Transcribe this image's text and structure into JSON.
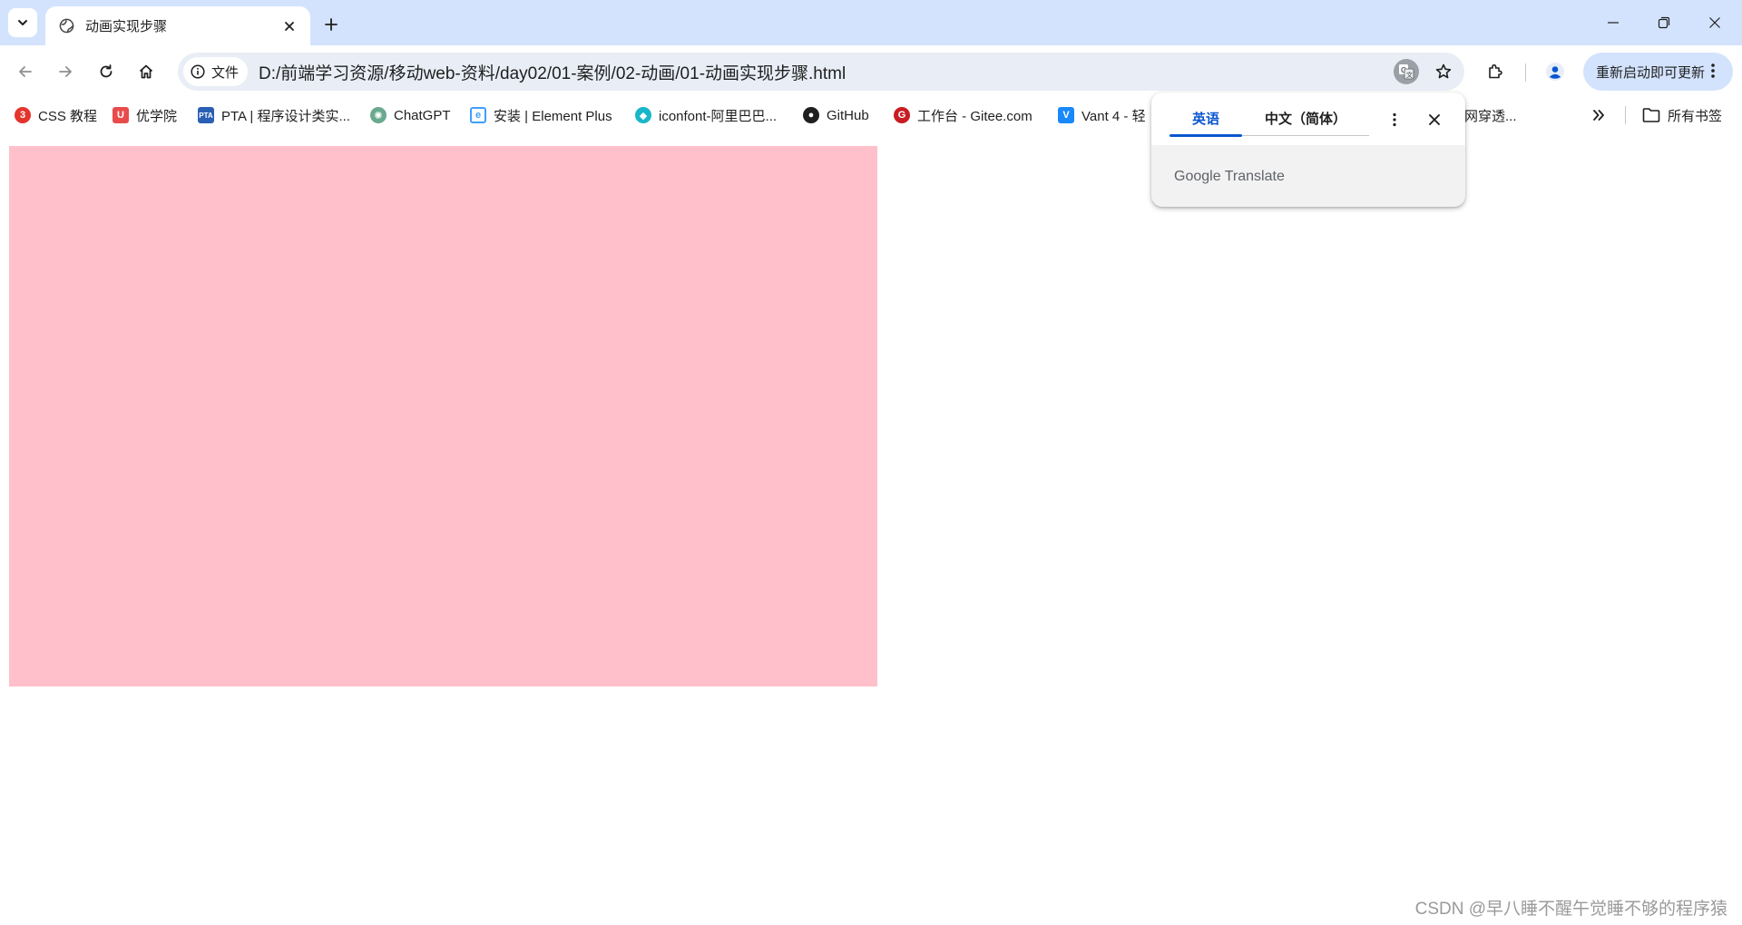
{
  "browser": {
    "tab": {
      "title": "动画实现步骤"
    },
    "omnibox": {
      "site_chip_label": "文件",
      "url": "D:/前端学习资源/移动web-资料/day02/01-案例/02-动画/01-动画实现步骤.html"
    },
    "update_button_label": "重新启动即可更新"
  },
  "bookmarks": {
    "items": [
      {
        "label": "CSS 教程",
        "icon": "css-tutorial-icon",
        "color": "#e5342c"
      },
      {
        "label": "优学院",
        "icon": "youxueyuan-icon",
        "color": "#e94b4b"
      },
      {
        "label": "PTA | 程序设计类实...",
        "icon": "pta-icon",
        "color": "#2b5fb4"
      },
      {
        "label": "ChatGPT",
        "icon": "chatgpt-icon",
        "color": "#6aa98f"
      },
      {
        "label": "安装 | Element Plus",
        "icon": "element-plus-icon",
        "color": "#409eff"
      },
      {
        "label": "iconfont-阿里巴巴...",
        "icon": "iconfont-icon",
        "color": "#19b6c9"
      },
      {
        "label": "GitHub",
        "icon": "github-icon",
        "color": "#1f1f1f"
      },
      {
        "label": "工作台 - Gitee.com",
        "icon": "gitee-icon",
        "color": "#c71d23"
      },
      {
        "label": "Vant 4 - 轻",
        "icon": "vant-icon",
        "color": "#1989fa"
      },
      {
        "label": "网穿透...",
        "icon": "generic-bookmark-icon",
        "color": "#888888"
      }
    ],
    "all_bookmarks_label": "所有书签"
  },
  "translate_popup": {
    "source_lang": "英语",
    "target_lang": "中文（简体）",
    "footer": "Google Translate"
  },
  "page": {
    "box_color": "#ffc0cb",
    "watermark": "CSDN @早八睡不醒午觉睡不够的程序猿"
  }
}
